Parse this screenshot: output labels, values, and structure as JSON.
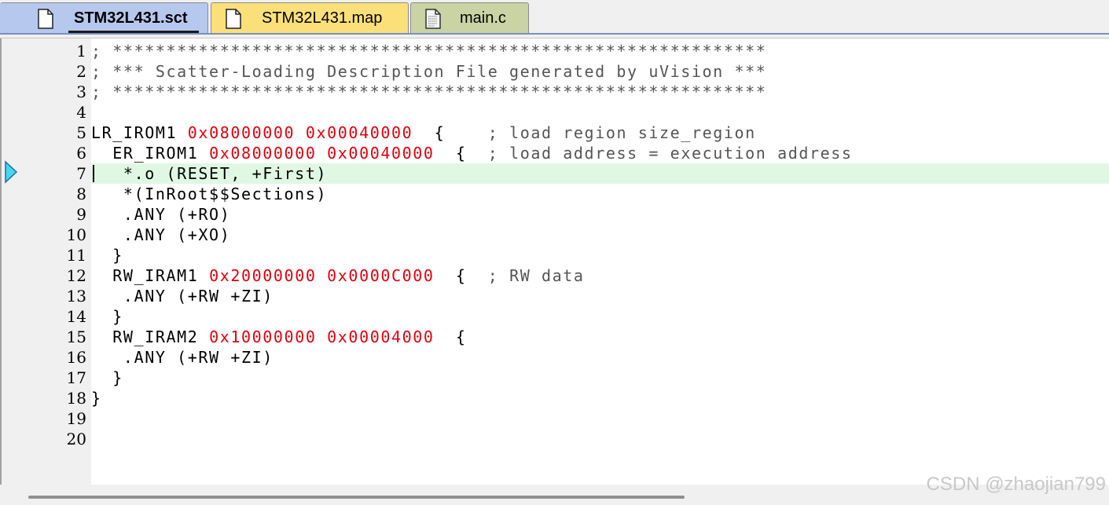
{
  "tabs": [
    {
      "label": "STM32L431.sct",
      "active": true,
      "color": "#b7c8ef"
    },
    {
      "label": "STM32L431.map",
      "active": false,
      "color": "#fbe07a"
    },
    {
      "label": "main.c",
      "active": false,
      "color": "#cad3a3"
    }
  ],
  "editor": {
    "line_numbers": [
      "1",
      "2",
      "3",
      "4",
      "5",
      "6",
      "7",
      "8",
      "9",
      "10",
      "11",
      "12",
      "13",
      "14",
      "15",
      "16",
      "17",
      "18",
      "19",
      "20"
    ],
    "current_line": 7,
    "lines": [
      {
        "code": "",
        "num1": "",
        "sp1": "",
        "num2": "",
        "rest": "",
        "comment": "; *************************************************************"
      },
      {
        "code": "",
        "num1": "",
        "sp1": "",
        "num2": "",
        "rest": "",
        "comment": "; *** Scatter-Loading Description File generated by uVision ***"
      },
      {
        "code": "",
        "num1": "",
        "sp1": "",
        "num2": "",
        "rest": "",
        "comment": "; *************************************************************"
      },
      {
        "code": "",
        "num1": "",
        "sp1": "",
        "num2": "",
        "rest": "",
        "comment": ""
      },
      {
        "code": "LR_IROM1 ",
        "num1": "0x08000000",
        "sp1": " ",
        "num2": "0x00040000",
        "rest": "  {    ",
        "comment": "; load region size_region"
      },
      {
        "code": "  ER_IROM1 ",
        "num1": "0x08000000",
        "sp1": " ",
        "num2": "0x00040000",
        "rest": "  {  ",
        "comment": "; load address = execution address"
      },
      {
        "code": "   *.o (RESET, +First)",
        "num1": "",
        "sp1": "",
        "num2": "",
        "rest": "",
        "comment": ""
      },
      {
        "code": "   *(InRoot$$Sections)",
        "num1": "",
        "sp1": "",
        "num2": "",
        "rest": "",
        "comment": ""
      },
      {
        "code": "   .ANY (+RO)",
        "num1": "",
        "sp1": "",
        "num2": "",
        "rest": "",
        "comment": ""
      },
      {
        "code": "   .ANY (+XO)",
        "num1": "",
        "sp1": "",
        "num2": "",
        "rest": "",
        "comment": ""
      },
      {
        "code": "  }",
        "num1": "",
        "sp1": "",
        "num2": "",
        "rest": "",
        "comment": ""
      },
      {
        "code": "  RW_IRAM1 ",
        "num1": "0x20000000",
        "sp1": " ",
        "num2": "0x0000C000",
        "rest": "  {  ",
        "comment": "; RW data"
      },
      {
        "code": "   .ANY (+RW +ZI)",
        "num1": "",
        "sp1": "",
        "num2": "",
        "rest": "",
        "comment": ""
      },
      {
        "code": "  }",
        "num1": "",
        "sp1": "",
        "num2": "",
        "rest": "",
        "comment": ""
      },
      {
        "code": "  RW_IRAM2 ",
        "num1": "0x10000000",
        "sp1": " ",
        "num2": "0x00004000",
        "rest": "  {",
        "comment": ""
      },
      {
        "code": "   .ANY (+RW +ZI)",
        "num1": "",
        "sp1": "",
        "num2": "",
        "rest": "",
        "comment": ""
      },
      {
        "code": "  }",
        "num1": "",
        "sp1": "",
        "num2": "",
        "rest": "",
        "comment": ""
      },
      {
        "code": "}",
        "num1": "",
        "sp1": "",
        "num2": "",
        "rest": "",
        "comment": ""
      },
      {
        "code": "",
        "num1": "",
        "sp1": "",
        "num2": "",
        "rest": "",
        "comment": ""
      },
      {
        "code": "",
        "num1": "",
        "sp1": "",
        "num2": "",
        "rest": "",
        "comment": ""
      }
    ]
  },
  "watermark": "CSDN @zhaojian799",
  "colors": {
    "comment": "#555555",
    "number": "#e0000c",
    "current_line_bg": "#e0f8e3",
    "exec_marker": "#44d7ee"
  },
  "icons": {
    "tab_file": "document-icon",
    "tab_c_file": "c-source-file-icon",
    "gutter": "execution-pointer-icon"
  }
}
